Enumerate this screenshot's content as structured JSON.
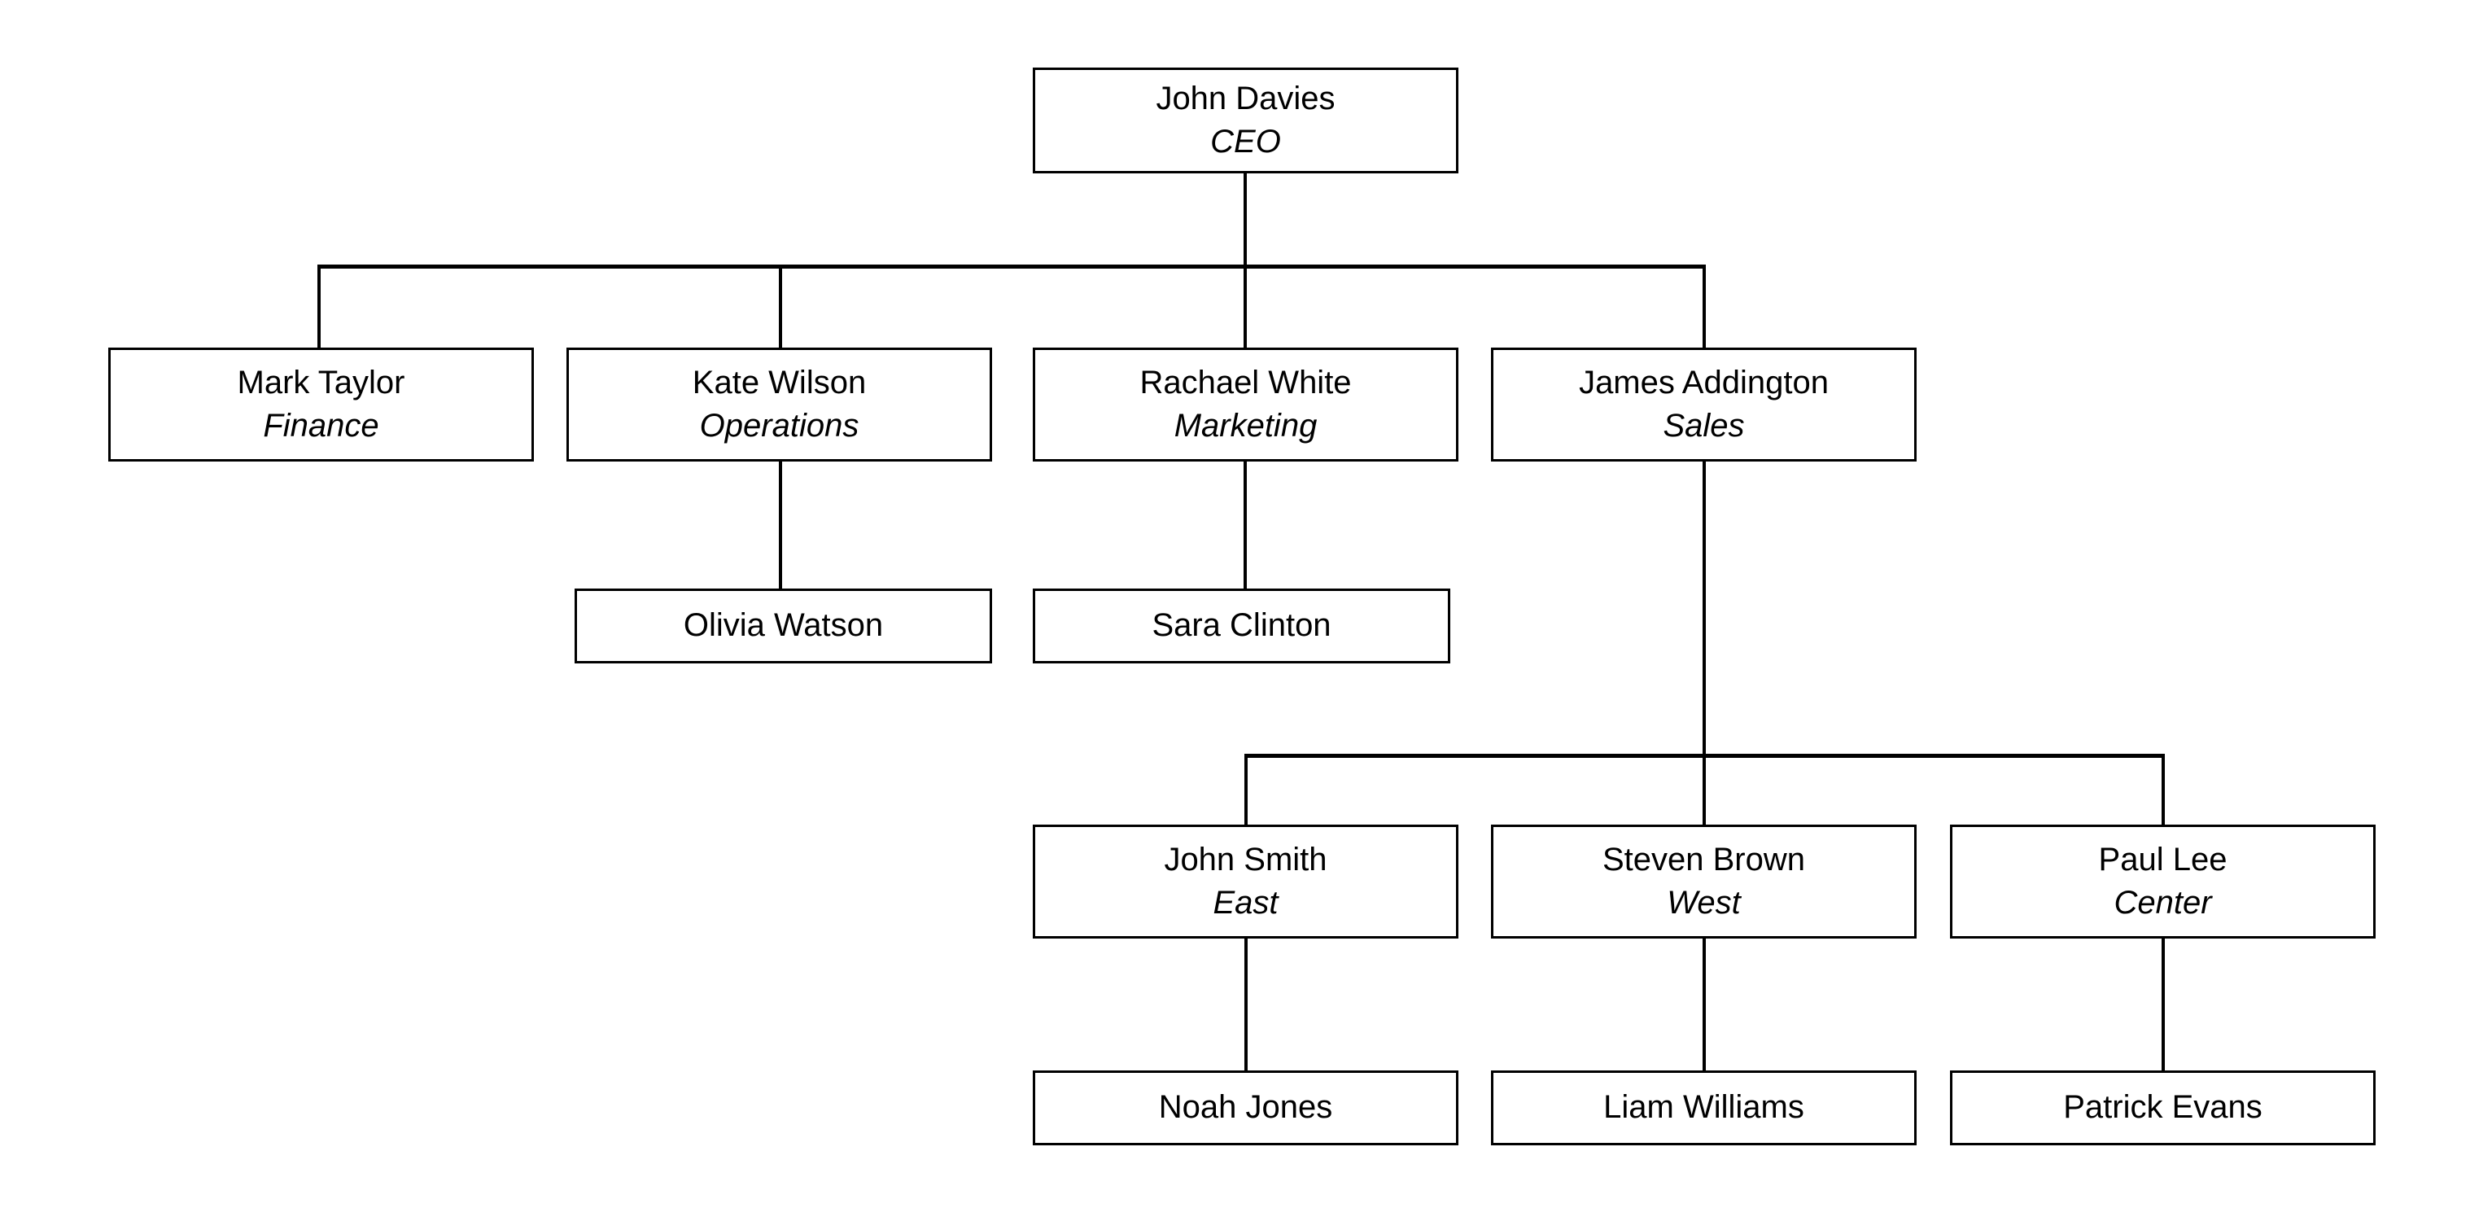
{
  "chart_data": {
    "type": "diagram",
    "diagram_type": "organizational-chart",
    "title": "",
    "orientation": "top-down",
    "levels": 5,
    "node_count": 13,
    "nodes": [
      {
        "id": "ceo",
        "name": "John Davies",
        "role": "CEO",
        "level": 1,
        "parent": null
      },
      {
        "id": "finance",
        "name": "Mark Taylor",
        "role": "Finance",
        "level": 2,
        "parent": "ceo"
      },
      {
        "id": "operations",
        "name": "Kate Wilson",
        "role": "Operations",
        "level": 2,
        "parent": "ceo"
      },
      {
        "id": "marketing",
        "name": "Rachael White",
        "role": "Marketing",
        "level": 2,
        "parent": "ceo"
      },
      {
        "id": "sales",
        "name": "James Addington",
        "role": "Sales",
        "level": 2,
        "parent": "ceo"
      },
      {
        "id": "olivia-watson",
        "name": "Olivia Watson",
        "role": "",
        "level": 3,
        "parent": "operations"
      },
      {
        "id": "sara-clinton",
        "name": "Sara Clinton",
        "role": "",
        "level": 3,
        "parent": "marketing"
      },
      {
        "id": "east",
        "name": "John Smith",
        "role": "East",
        "level": 4,
        "parent": "sales"
      },
      {
        "id": "west",
        "name": "Steven Brown",
        "role": "West",
        "level": 4,
        "parent": "sales"
      },
      {
        "id": "center",
        "name": "Paul Lee",
        "role": "Center",
        "level": 4,
        "parent": "sales"
      },
      {
        "id": "noah-jones",
        "name": "Noah Jones",
        "role": "",
        "level": 5,
        "parent": "east"
      },
      {
        "id": "liam-williams",
        "name": "Liam Williams",
        "role": "",
        "level": 5,
        "parent": "west"
      },
      {
        "id": "patrick-evans",
        "name": "Patrick Evans",
        "role": "",
        "level": 5,
        "parent": "center"
      }
    ],
    "edges": [
      {
        "from": "ceo",
        "to": "finance"
      },
      {
        "from": "ceo",
        "to": "operations"
      },
      {
        "from": "ceo",
        "to": "marketing"
      },
      {
        "from": "ceo",
        "to": "sales"
      },
      {
        "from": "operations",
        "to": "olivia-watson"
      },
      {
        "from": "marketing",
        "to": "sara-clinton"
      },
      {
        "from": "sales",
        "to": "east"
      },
      {
        "from": "sales",
        "to": "west"
      },
      {
        "from": "sales",
        "to": "center"
      },
      {
        "from": "east",
        "to": "noah-jones"
      },
      {
        "from": "west",
        "to": "liam-williams"
      },
      {
        "from": "center",
        "to": "patrick-evans"
      }
    ],
    "style": {
      "box_fill": "#ffffff",
      "box_border": "#000000",
      "connector_color": "#000000",
      "background": "#ffffff",
      "name_style": "normal",
      "role_style": "italic"
    }
  },
  "nodes": {
    "ceo": {
      "name": "John Davies",
      "role": "CEO"
    },
    "finance": {
      "name": "Mark Taylor",
      "role": "Finance"
    },
    "operations": {
      "name": "Kate Wilson",
      "role": "Operations"
    },
    "marketing": {
      "name": "Rachael White",
      "role": "Marketing"
    },
    "sales": {
      "name": "James Addington",
      "role": "Sales"
    },
    "olivia_watson": {
      "name": "Olivia Watson"
    },
    "sara_clinton": {
      "name": "Sara Clinton"
    },
    "east": {
      "name": "John Smith",
      "role": "East"
    },
    "west": {
      "name": "Steven Brown",
      "role": "West"
    },
    "center": {
      "name": "Paul Lee",
      "role": "Center"
    },
    "noah_jones": {
      "name": "Noah Jones"
    },
    "liam_williams": {
      "name": "Liam Williams"
    },
    "patrick_evans": {
      "name": "Patrick Evans"
    }
  }
}
